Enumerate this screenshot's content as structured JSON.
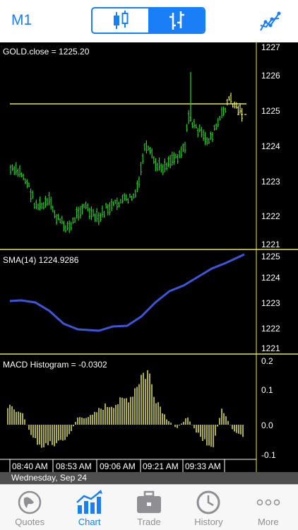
{
  "header": {
    "timeframe": "M1"
  },
  "main_chart": {
    "label": "GOLD.close = 1225.20",
    "y_ticks": [
      "1227",
      "1226",
      "1225",
      "1224",
      "1223",
      "1222",
      "1221"
    ]
  },
  "sma_panel": {
    "label": "SMA(14) 1224.9286",
    "y_ticks": [
      "1225",
      "1224",
      "1223",
      "1222",
      "1221"
    ]
  },
  "macd_panel": {
    "label": "MACD Histogram = -0.0302",
    "y_ticks": [
      "0.2",
      "0.1",
      "0.0",
      "-0.1"
    ]
  },
  "time_axis": {
    "ticks": [
      "08:40 AM",
      "08:53 AM",
      "09:06 AM",
      "09:21 AM",
      "09:33 AM"
    ]
  },
  "date_bar": {
    "date": "Wednesday, Sep 24"
  },
  "tabbar": {
    "items": [
      {
        "label": "Quotes",
        "icon": "globe-icon"
      },
      {
        "label": "Chart",
        "icon": "chart-icon"
      },
      {
        "label": "Trade",
        "icon": "briefcase-icon"
      },
      {
        "label": "History",
        "icon": "clock-icon"
      },
      {
        "label": "More",
        "icon": "more-icon"
      }
    ],
    "active": "Chart"
  },
  "colors": {
    "accent": "#1a7ff5",
    "bars": "#22cc22",
    "level": "#e6e65a",
    "sma": "#3f55d6",
    "macd": "#e6e65a"
  }
}
